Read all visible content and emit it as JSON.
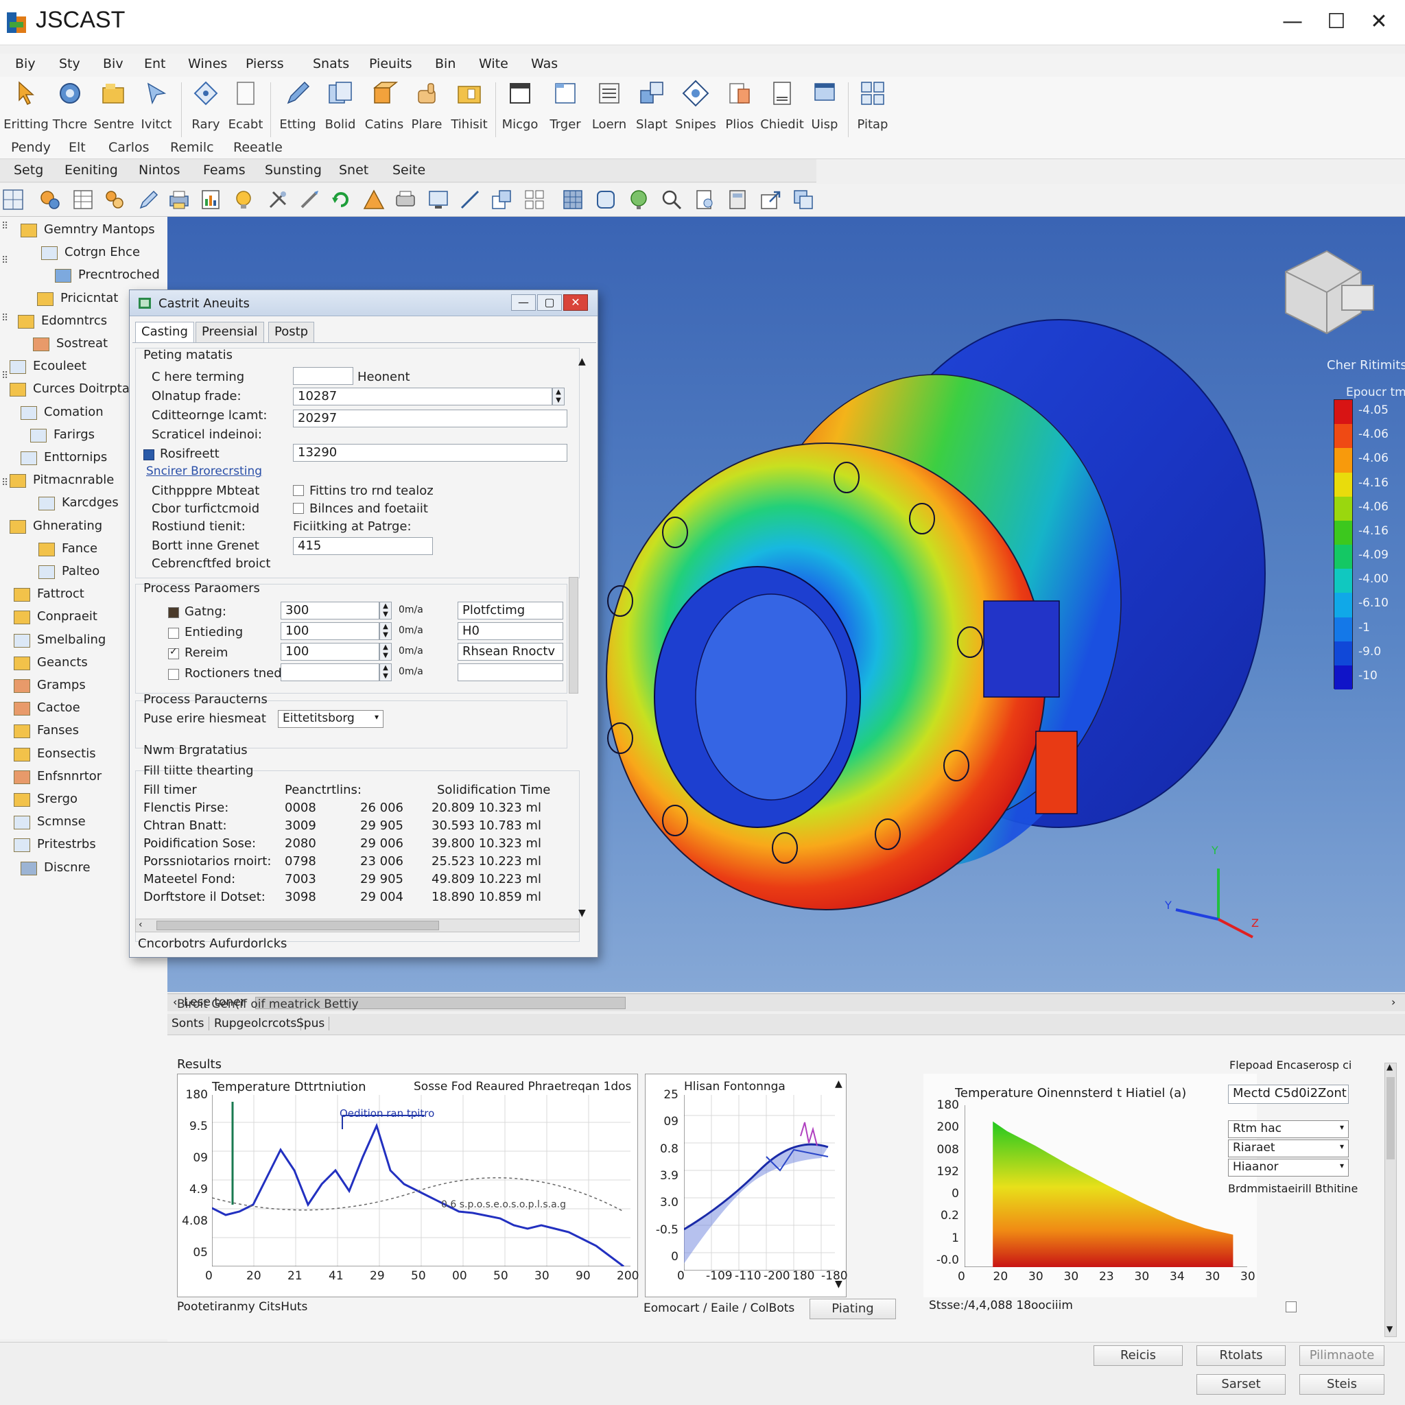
{
  "app": {
    "title": "JSCAST"
  },
  "window_controls": {
    "minimize": "—",
    "maximize": "☐",
    "close": "✕"
  },
  "menu": [
    "Biy",
    "Sty",
    "Biv",
    "Ent",
    "Wines",
    "Pierss",
    "Snats",
    "Pieuits",
    "Bin",
    "Wite",
    "Was"
  ],
  "ribbon": {
    "buttons": [
      "Eritting",
      "Thcre",
      "Sentre",
      "Ivitct",
      "Rary",
      "Ecabt",
      "Etting",
      "Bolid",
      "Catins",
      "Plare",
      "Tihisit",
      "Micgo",
      "Trger",
      "Loern",
      "Slapt",
      "Snipes",
      "Plios",
      "Chiedit",
      "Uisp",
      "Pitap"
    ],
    "groups": [
      "Pendy",
      "Elt",
      "Carlos",
      "Remilc",
      "Reeatle"
    ]
  },
  "secondary_tabs": [
    "Setg",
    "Eeniting",
    "Nintos",
    "Feams",
    "Sunsting",
    "Snet",
    "Seite"
  ],
  "tree": [
    "Gemntry Mantops",
    "Cotrgn Ehce",
    "Precntroched",
    "Pricicntat",
    "Edomntrcs",
    "Sostreat",
    "Ecouleet",
    "Curces Doitrptas",
    "Comation",
    "Farirgs",
    "Enttornips",
    "Pitmacnrable",
    "Karcdges",
    "Ghnerating",
    "Fance",
    "Palteo",
    "Fattroct",
    "Conpraeit",
    "Smelbaling",
    "Geancts",
    "Gramps",
    "Cactoe",
    "Fanses",
    "Eonsectis",
    "Enfsnnrtor",
    "Srergo",
    "Scmnse",
    "Pritestrbs",
    "Discnre"
  ],
  "dialog": {
    "title": "Castrit Aneuits",
    "controls": {
      "min": "—",
      "max": "▢",
      "close": "✕"
    },
    "tabs": [
      "Casting",
      "Preensial",
      "Postp"
    ],
    "section1": {
      "title": "Peting matatis",
      "rows": [
        {
          "label": "C here terming",
          "value": "",
          "after": "Heonent"
        },
        {
          "label": "Olnatup frade:",
          "value": "10287"
        },
        {
          "label": "Cditteornge lcamt:",
          "value": "20297"
        },
        {
          "label": "Scraticel indeinoi:",
          "value": ""
        },
        {
          "label": "Rosifreett",
          "value": "13290"
        }
      ],
      "link": "Sncirer Brorecrsting",
      "rows2": [
        {
          "label": "Cithpppre Mbteat",
          "check": "Fittins tro rnd tealoz"
        },
        {
          "label": "Cbor turfictcmoid",
          "check": "Bilnces and foetaiit"
        },
        {
          "label": "Rostiund tienit:",
          "check": "Ficiitking at Patrge:"
        },
        {
          "label": "Bortt inne Grenet",
          "value": "415"
        },
        {
          "label": "Cebrencftfed broict"
        }
      ]
    },
    "section2": {
      "title": "Process Paraomers",
      "unit": "0m/a",
      "rows": [
        {
          "label": "Gatng:",
          "value": "300",
          "side": "Plotfctimg"
        },
        {
          "label": "Entieding",
          "value": "100",
          "side": "H0"
        },
        {
          "label": "Rereim",
          "value": "100",
          "side": "Rhsean Rnoctv"
        },
        {
          "label": "Roctioners tned",
          "value": "",
          "side": ""
        }
      ]
    },
    "section3": {
      "title": "Process Paraucterns",
      "label": "Puse erire hiesmeat",
      "value": "Eittetitsborg"
    },
    "section4": {
      "title": "Nwm Brgratatius"
    },
    "section5": {
      "title": "Fill tiitte thearting",
      "headers": [
        "Fill timer",
        "Peanctrtlins:",
        "Solidification Time"
      ],
      "rows": [
        [
          "Flenctis Pirse:",
          "0008",
          "26 006",
          "20.809 10.323 ml"
        ],
        [
          "Chtran Bnatt:",
          "3009",
          "29 905",
          "30.593 10.783 ml"
        ],
        [
          "Poidification Sose:",
          "2080",
          "29 006",
          "39.800 10.323 ml"
        ],
        [
          "Porssniotarios rnoirt:",
          "0798",
          "23 006",
          "25.523 10.223 ml"
        ],
        [
          "Mateetel Fond:",
          "7003",
          "29 905",
          "49.809 10.223 ml"
        ],
        [
          "Dorftstore il Dotset:",
          "3098",
          "29 004",
          "18.890 10.859 ml"
        ]
      ]
    },
    "footer": "Cncorbotrs Aufurdorlcks"
  },
  "viewport": {
    "legend_title": "Cher Ritimits",
    "legend_subtitle": "Epoucr tme",
    "legend_values": [
      "-4.05",
      "-4.06",
      "-4.06",
      "-4.16",
      "-4.06",
      "-4.16",
      "-4.09",
      "-4.00",
      "-6.10",
      "-1",
      "-9.0",
      "-10"
    ],
    "legend_colors": [
      "#d81414",
      "#ef4a14",
      "#f89a0c",
      "#e9dc0c",
      "#9ad70e",
      "#3cc81e",
      "#14c864",
      "#10c8c0",
      "#10a8e8",
      "#1478e8",
      "#1048d8",
      "#1014c8"
    ],
    "axis": {
      "y": "Y",
      "x": "Y",
      "z": "Z"
    }
  },
  "scroll_label": "Lese toner",
  "bottom_tabs_row1": "Biroit  Gen(if oif meatrick  Bettiy",
  "bottom_tabs": [
    "Sonts",
    "Rupgeolcrcots",
    "Spus"
  ],
  "results_label": "Results",
  "chart1": {
    "title": "Temperature Dttrtniution",
    "title2": "Sosse Fod Reaured Phraetreqan 1dos",
    "annotation": "Oedition ran tpitro",
    "dotted_annotation": "0.6 s.p.o.s.e.o.s.o.p.l.s.a.g",
    "yticks": [
      "180",
      "9.5",
      "09",
      "4.9",
      "4.08",
      "05"
    ],
    "xticks": [
      "0",
      "20",
      "21",
      "41",
      "29",
      "50",
      "00",
      "50",
      "30",
      "90",
      "200"
    ],
    "footer": "Pootetiranmy CitsHuts"
  },
  "chart2": {
    "title": "Hlisan Fontonnga",
    "yticks": [
      "25",
      "09",
      "0.8",
      "3.9",
      "3.0",
      "-0.5",
      "0"
    ],
    "xticks": [
      "0",
      "-109",
      "-110",
      "-200",
      "180",
      "-180"
    ],
    "footer": "Eomocart / Eaile / ColBots",
    "button": "Piating"
  },
  "chart3": {
    "title": "Temperature Oinennsterd t Hiatiel (a)",
    "yticks": [
      "180",
      "200",
      "008",
      "192",
      "0",
      "0.2",
      "1",
      "-0.0"
    ],
    "xticks": [
      "0",
      "20",
      "30",
      "30",
      "23",
      "30",
      "34",
      "30",
      "30"
    ],
    "footer": "Stsse:/4,4,088 18oociiim",
    "side_title": "Flepoad Encaserosp ci",
    "side_input": "Mectd C5d0i2Zont",
    "side_selects": [
      "Rtm hac",
      "Riaraet",
      "Hiaanor"
    ],
    "side_caption": "Brdmmistaeirill Bthitine",
    "curve": {
      "x": [
        4,
        6,
        10,
        15,
        20,
        25,
        30,
        34,
        38
      ],
      "y": [
        180,
        168,
        150,
        125,
        102,
        80,
        60,
        48,
        40
      ]
    }
  },
  "footer_buttons": [
    "Reicis",
    "Rtolats",
    "Pilimnaote",
    "Sarset",
    "Steis"
  ]
}
